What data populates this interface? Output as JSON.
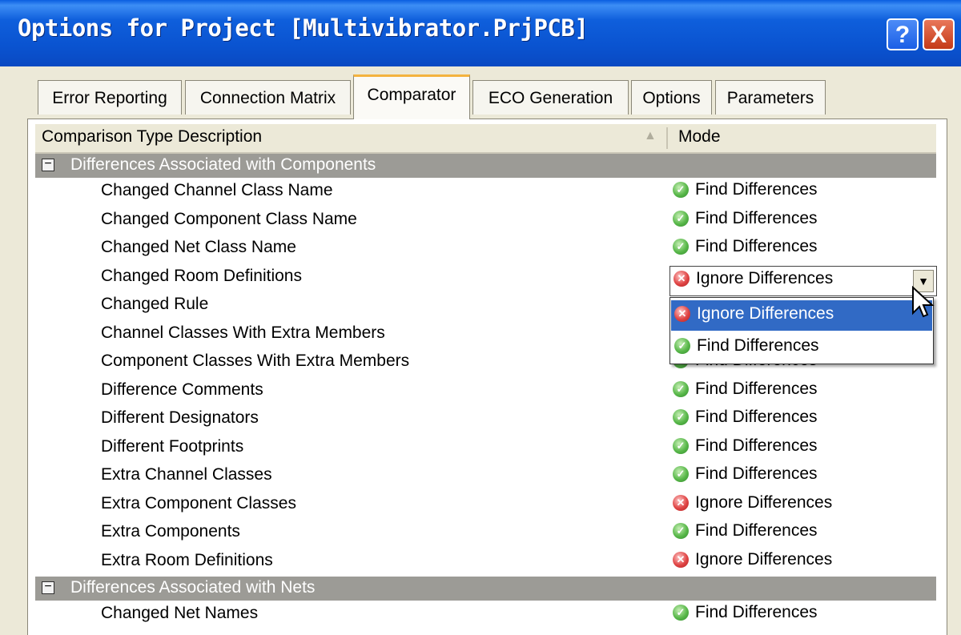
{
  "window": {
    "title": "Options for Project [Multivibrator.PrjPCB]"
  },
  "titlebar_buttons": {
    "help": "?",
    "close": "X"
  },
  "tabs": [
    {
      "label": "Error Reporting",
      "active": false
    },
    {
      "label": "Connection Matrix",
      "active": false
    },
    {
      "label": "Comparator",
      "active": true
    },
    {
      "label": "ECO Generation",
      "active": false
    },
    {
      "label": "Options",
      "active": false
    },
    {
      "label": "Parameters",
      "active": false
    }
  ],
  "columns": {
    "description": "Comparison Type Description",
    "mode": "Mode",
    "sort_indicator": "▲"
  },
  "group_toggle": "−",
  "groups": [
    {
      "label": "Differences Associated with Components",
      "rows": [
        {
          "desc": "Changed Channel Class Name",
          "mode": "Find Differences",
          "status": "find"
        },
        {
          "desc": "Changed Component Class Name",
          "mode": "Find Differences",
          "status": "find"
        },
        {
          "desc": "Changed Net Class Name",
          "mode": "Find Differences",
          "status": "find"
        },
        {
          "desc": "Changed Room Definitions",
          "mode": "Ignore Differences",
          "status": "ignore",
          "editing": true
        },
        {
          "desc": "Changed Rule",
          "mode": "",
          "status": "hidden"
        },
        {
          "desc": "Channel Classes With Extra Members",
          "mode": "",
          "status": "hidden"
        },
        {
          "desc": "Component Classes With Extra Members",
          "mode": "Find Differences",
          "status": "find"
        },
        {
          "desc": "Difference Comments",
          "mode": "Find Differences",
          "status": "find"
        },
        {
          "desc": "Different Designators",
          "mode": "Find Differences",
          "status": "find"
        },
        {
          "desc": "Different Footprints",
          "mode": "Find Differences",
          "status": "find"
        },
        {
          "desc": "Extra Channel Classes",
          "mode": "Find Differences",
          "status": "find"
        },
        {
          "desc": "Extra Component Classes",
          "mode": "Ignore Differences",
          "status": "ignore"
        },
        {
          "desc": "Extra Components",
          "mode": "Find Differences",
          "status": "find"
        },
        {
          "desc": "Extra Room Definitions",
          "mode": "Ignore Differences",
          "status": "ignore"
        }
      ]
    },
    {
      "label": "Differences Associated with Nets",
      "rows": [
        {
          "desc": "Changed Net Names",
          "mode": "Find Differences",
          "status": "find"
        }
      ]
    }
  ],
  "combo": {
    "value": "Ignore Differences",
    "status": "ignore",
    "arrow": "▼"
  },
  "dropdown": {
    "options": [
      {
        "label": "Ignore Differences",
        "status": "ignore",
        "selected": true
      },
      {
        "label": "Find Differences",
        "status": "find",
        "selected": false
      }
    ]
  },
  "icons": {
    "find": "check-icon",
    "ignore": "x-icon"
  },
  "colors": {
    "titlebar": "#0a53d0",
    "selection": "#316ac5",
    "group_header": "#9c9b96",
    "find_icon": "#59b84a",
    "ignore_icon": "#e04545",
    "active_tab_accent": "#f4b33f"
  }
}
